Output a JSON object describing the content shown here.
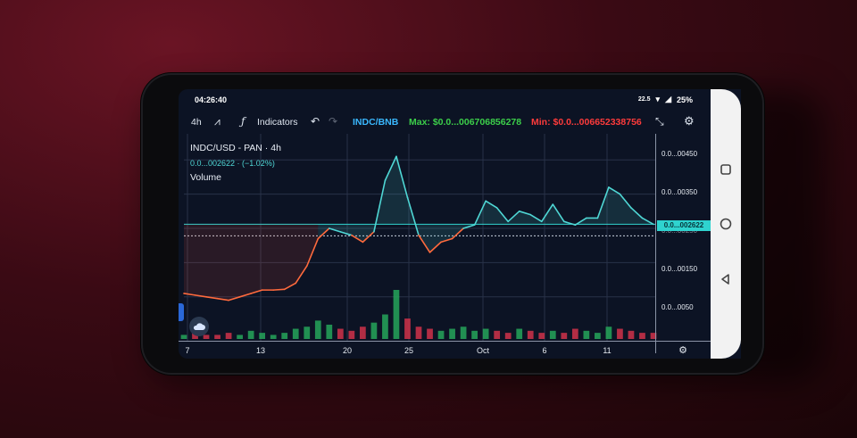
{
  "status_bar": {
    "time": "04:26:40",
    "data_speed": "22.5",
    "battery": "25%"
  },
  "toolbar": {
    "interval": "4h",
    "indicators_label": "Indicators",
    "pair": "INDC/BNB",
    "max_label": "Max: $0.0...006706856278",
    "min_label": "Min: $0.0...006652338756"
  },
  "legend": {
    "title": "INDC/USD - PAN · 4h",
    "value": "0.0...002622 · (−1.02%)",
    "volume_label": "Volume"
  },
  "price_axis": {
    "ticks": [
      "0.0...00450",
      "0.0...00350",
      "0.0...00250",
      "0.0...00150",
      "0.0...0050"
    ],
    "current_price": "0.0...002622"
  },
  "time_axis": {
    "ticks": [
      "7",
      "13",
      "20",
      "25",
      "Oct",
      "6",
      "11"
    ]
  },
  "colors": {
    "up": "#4fd7d5",
    "down": "#ff6a3d",
    "max": "#3ccf4a",
    "min": "#ff3b3b",
    "pair": "#3ab8ff"
  },
  "chart_data": {
    "type": "line",
    "series": [
      {
        "values": [
          0.0006,
          0.00055,
          0.0005,
          0.00045,
          0.0004,
          0.0005,
          0.0006,
          0.0007,
          0.0007,
          0.00072,
          0.0009,
          0.0014,
          0.0022,
          0.0025,
          0.0024,
          0.0023,
          0.0021,
          0.0024,
          0.0039,
          0.0046,
          0.0034,
          0.0023,
          0.0018,
          0.0021,
          0.0022,
          0.0025,
          0.0026,
          0.0033,
          0.0031,
          0.0027,
          0.003,
          0.0029,
          0.0027,
          0.0032,
          0.0027,
          0.0026,
          0.0028,
          0.0028,
          0.0037,
          0.0035,
          0.0031,
          0.0028,
          0.00262
        ]
      }
    ],
    "volume": [
      2,
      3,
      2,
      2,
      3,
      2,
      4,
      3,
      2,
      3,
      5,
      6,
      9,
      7,
      5,
      4,
      6,
      8,
      12,
      24,
      10,
      6,
      5,
      4,
      5,
      6,
      4,
      5,
      4,
      3,
      5,
      4,
      3,
      4,
      3,
      5,
      4,
      3,
      6,
      5,
      4,
      3,
      3
    ],
    "current_price": 0.002622,
    "ylim": [
      0.0,
      0.005
    ],
    "price_tick_values": [
      0.0045,
      0.0035,
      0.0025,
      0.0015,
      0.0005
    ],
    "grid": true
  }
}
